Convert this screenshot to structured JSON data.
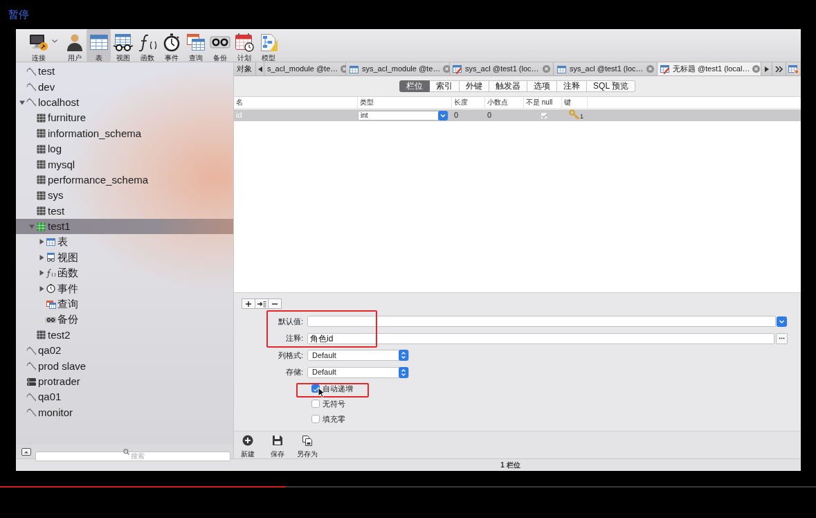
{
  "player": {
    "status": "暂停",
    "progress": {
      "level": 0.35
    }
  },
  "toolbar": {
    "items": [
      {
        "label": "连接",
        "kind": "connect",
        "selected": false,
        "menu": true
      },
      {
        "label": "用户",
        "kind": "user",
        "selected": false,
        "menu": false
      },
      {
        "label": "表",
        "kind": "table",
        "selected": true,
        "menu": false
      },
      {
        "label": "视图",
        "kind": "view",
        "selected": false,
        "menu": false
      },
      {
        "label": "函数",
        "kind": "function",
        "selected": false,
        "menu": false
      },
      {
        "label": "事件",
        "kind": "event",
        "selected": false,
        "menu": false
      },
      {
        "label": "查询",
        "kind": "query",
        "selected": false,
        "menu": false
      },
      {
        "label": "备份",
        "kind": "backup",
        "selected": false,
        "menu": false
      },
      {
        "label": "计划",
        "kind": "schedule",
        "selected": false,
        "menu": false
      },
      {
        "label": "模型",
        "kind": "model",
        "selected": false,
        "menu": false
      }
    ]
  },
  "sidebar": {
    "tree": [
      {
        "label": "test",
        "kind": "connection",
        "selected": false
      },
      {
        "label": "dev",
        "kind": "connection",
        "selected": false
      },
      {
        "label": "localhost",
        "kind": "connection",
        "selected": false,
        "expanded": true,
        "children": [
          {
            "label": "furniture",
            "kind": "database",
            "selected": false
          },
          {
            "label": "information_schema",
            "kind": "database",
            "selected": false
          },
          {
            "label": "log",
            "kind": "database",
            "selected": false
          },
          {
            "label": "mysql",
            "kind": "database",
            "selected": false
          },
          {
            "label": "performance_schema",
            "kind": "database",
            "selected": false
          },
          {
            "label": "sys",
            "kind": "database",
            "selected": false
          },
          {
            "label": "test",
            "kind": "database",
            "selected": false
          },
          {
            "label": "test1",
            "kind": "database-open",
            "selected": true,
            "expanded": true,
            "children": [
              {
                "label": "表",
                "kind": "tables",
                "selected": false,
                "expanded": false
              },
              {
                "label": "视图",
                "kind": "views",
                "selected": false,
                "expanded": false
              },
              {
                "label": "函数",
                "kind": "functions",
                "selected": false,
                "expanded": false
              },
              {
                "label": "事件",
                "kind": "events",
                "selected": false,
                "expanded": false
              },
              {
                "label": "查询",
                "kind": "queries",
                "selected": false
              },
              {
                "label": "备份",
                "kind": "backups",
                "selected": false
              }
            ]
          },
          {
            "label": "test2",
            "kind": "database",
            "selected": false
          }
        ]
      },
      {
        "label": "qa02",
        "kind": "connection",
        "selected": false
      },
      {
        "label": "prod slave",
        "kind": "connection",
        "selected": false
      },
      {
        "label": "protrader",
        "kind": "server",
        "selected": false
      },
      {
        "label": "qa01",
        "kind": "connection",
        "selected": false
      },
      {
        "label": "monitor",
        "kind": "connection",
        "selected": false
      }
    ],
    "search": {
      "placeholder": "搜索"
    }
  },
  "editor": {
    "tabs": [
      {
        "label": "对象",
        "kind": "objects",
        "selected": false
      },
      {
        "label": "s_acl_module @te…",
        "kind": "clipped",
        "selected": false
      },
      {
        "label": "sys_acl_module @te…",
        "kind": "table",
        "selected": false
      },
      {
        "label": "sys_acl @test1 (loc…",
        "kind": "design",
        "selected": false
      },
      {
        "label": "sys_acl @test1 (loc…",
        "kind": "table",
        "selected": false
      },
      {
        "label": "无标题 @test1 (local…",
        "kind": "design",
        "selected": true
      }
    ],
    "subtabs": [
      {
        "label": "栏位",
        "selected": true
      },
      {
        "label": "索引",
        "selected": false
      },
      {
        "label": "外键",
        "selected": false
      },
      {
        "label": "触发器",
        "selected": false
      },
      {
        "label": "选项",
        "selected": false
      },
      {
        "label": "注释",
        "selected": false
      },
      {
        "label": "SQL 预览",
        "selected": false
      }
    ]
  },
  "fields": {
    "columns": [
      "名",
      "类型",
      "长度",
      "小数点",
      "不是 null",
      "键"
    ],
    "rows": [
      {
        "name": "id",
        "type": "int",
        "length": "0",
        "decimals": "0",
        "not_null": true,
        "key": "1",
        "selected": true
      }
    ]
  },
  "properties": {
    "rows": [
      {
        "label": "默认值:",
        "kind": "combo",
        "marked": true
      },
      {
        "label": "注释:",
        "kind": "text",
        "value": "角色id",
        "marked": true
      },
      {
        "label": "列格式:",
        "kind": "popup",
        "value": "Default",
        "marked": false
      },
      {
        "label": "存储:",
        "kind": "popup",
        "value": "Default",
        "marked": false
      }
    ],
    "options": [
      {
        "label": "自动递增",
        "checked": true,
        "marked": true
      },
      {
        "label": "无符号",
        "checked": false,
        "marked": false
      },
      {
        "label": "填充零",
        "checked": false,
        "marked": false
      }
    ]
  },
  "bottom_toolbar": [
    {
      "label": "新建",
      "kind": "new"
    },
    {
      "label": "保存",
      "kind": "save"
    },
    {
      "label": "另存为",
      "kind": "save-as"
    }
  ],
  "status_bar": "1 栏位"
}
